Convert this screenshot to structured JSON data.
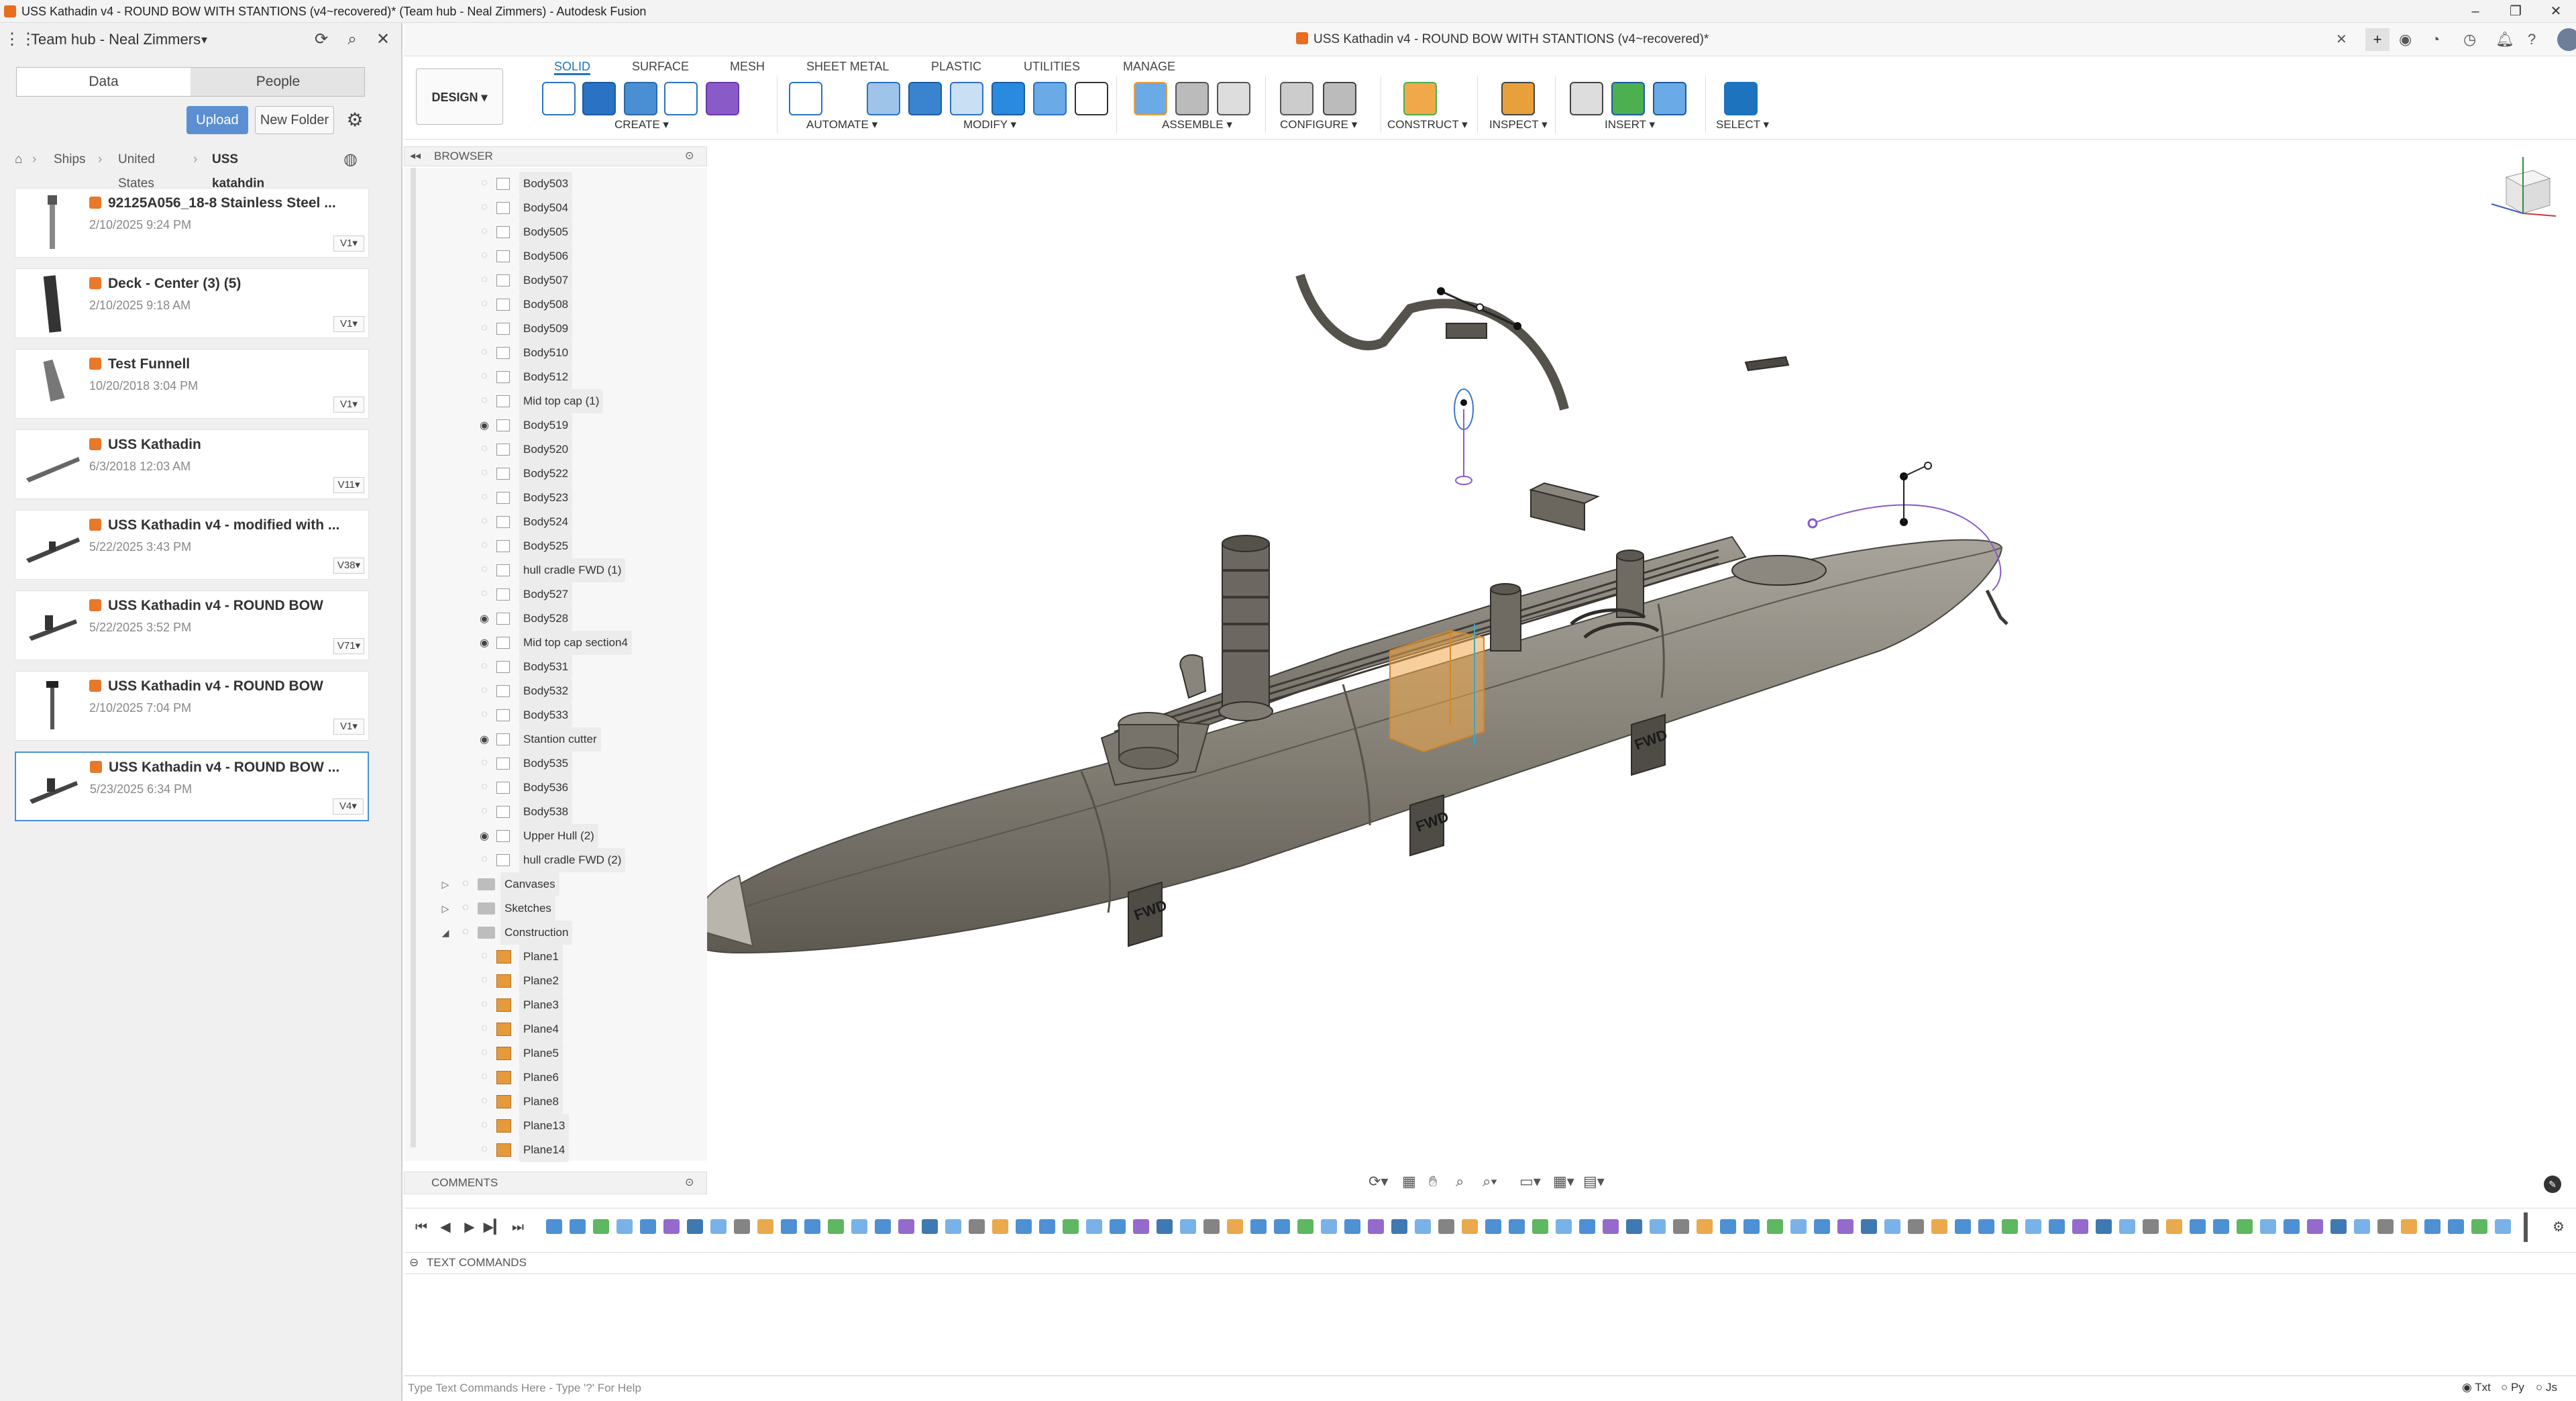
{
  "window": {
    "title": "USS Kathadin v4 - ROUND BOW WITH STANTIONS (v4~recovered)* (Team hub - Neal Zimmers) - Autodesk Fusion",
    "controls": [
      "–",
      "❐",
      "✕"
    ]
  },
  "left_panel": {
    "hub_name": "Team hub - Neal Zimmers",
    "tabs": [
      "Data",
      "People"
    ],
    "active_tab": "Data",
    "upload_label": "Upload",
    "new_folder_label": "New Folder",
    "breadcrumb": [
      "Ships",
      "United States",
      "USS katahdin"
    ],
    "files": [
      {
        "name": "92125A056_18-8 Stainless Steel ...",
        "date": "2/10/2025 9:24 PM",
        "version": "V1▾"
      },
      {
        "name": "Deck - Center (3) (5)",
        "date": "2/10/2025 9:18 AM",
        "version": "V1▾"
      },
      {
        "name": "Test Funnell",
        "date": "10/20/2018 3:04 PM",
        "version": "V1▾"
      },
      {
        "name": "USS Kathadin",
        "date": "6/3/2018 12:03 AM",
        "version": "V11▾"
      },
      {
        "name": "USS Kathadin v4 - modified with ...",
        "date": "5/22/2025 3:43 PM",
        "version": "V38▾"
      },
      {
        "name": "USS Kathadin v4 - ROUND BOW",
        "date": "5/22/2025 3:52 PM",
        "version": "V71▾"
      },
      {
        "name": "USS Kathadin v4 - ROUND BOW",
        "date": "2/10/2025 7:04 PM",
        "version": "V1▾"
      },
      {
        "name": "USS Kathadin v4 - ROUND BOW ...",
        "date": "5/23/2025 6:34 PM",
        "version": "V4▾"
      }
    ]
  },
  "document_tab": {
    "title": "USS Kathadin v4 - ROUND BOW WITH STANTIONS (v4~recovered)*"
  },
  "toolbar": {
    "workspace": "DESIGN ▾",
    "tabs": [
      "SOLID",
      "SURFACE",
      "MESH",
      "SHEET METAL",
      "PLASTIC",
      "UTILITIES",
      "MANAGE"
    ],
    "active_tab": "SOLID",
    "groups": [
      "CREATE ▾",
      "AUTOMATE ▾",
      "MODIFY ▾",
      "ASSEMBLE ▾",
      "CONFIGURE ▾",
      "CONSTRUCT ▾",
      "INSPECT ▾",
      "INSERT ▾",
      "SELECT ▾"
    ]
  },
  "browser": {
    "header": "BROWSER",
    "bodies": [
      {
        "label": "Body503",
        "visible": false
      },
      {
        "label": "Body504",
        "visible": false
      },
      {
        "label": "Body505",
        "visible": false
      },
      {
        "label": "Body506",
        "visible": false
      },
      {
        "label": "Body507",
        "visible": false
      },
      {
        "label": "Body508",
        "visible": false
      },
      {
        "label": "Body509",
        "visible": false
      },
      {
        "label": "Body510",
        "visible": false
      },
      {
        "label": "Body512",
        "visible": false
      },
      {
        "label": "Mid top cap (1)",
        "visible": false
      },
      {
        "label": "Body519",
        "visible": true
      },
      {
        "label": "Body520",
        "visible": false
      },
      {
        "label": "Body522",
        "visible": false
      },
      {
        "label": "Body523",
        "visible": false
      },
      {
        "label": "Body524",
        "visible": false
      },
      {
        "label": "Body525",
        "visible": false
      },
      {
        "label": "hull cradle FWD (1)",
        "visible": false
      },
      {
        "label": "Body527",
        "visible": false
      },
      {
        "label": "Body528",
        "visible": true
      },
      {
        "label": "Mid top cap section4",
        "visible": true
      },
      {
        "label": "Body531",
        "visible": false
      },
      {
        "label": "Body532",
        "visible": false
      },
      {
        "label": "Body533",
        "visible": false
      },
      {
        "label": "Stantion cutter",
        "visible": true
      },
      {
        "label": "Body535",
        "visible": false
      },
      {
        "label": "Body536",
        "visible": false
      },
      {
        "label": "Body538",
        "visible": false
      },
      {
        "label": "Upper Hull (2)",
        "visible": true
      },
      {
        "label": "hull cradle FWD (2)",
        "visible": false
      }
    ],
    "folders": [
      {
        "label": "Canvases",
        "expanded": false
      },
      {
        "label": "Sketches",
        "expanded": false
      },
      {
        "label": "Construction",
        "expanded": true
      }
    ],
    "planes": [
      "Plane1",
      "Plane2",
      "Plane3",
      "Plane4",
      "Plane5",
      "Plane6",
      "Plane8",
      "Plane13",
      "Plane14"
    ]
  },
  "comments_label": "COMMENTS",
  "text_commands": {
    "header": "TEXT COMMANDS",
    "placeholder": "Type Text Commands Here - Type '?' For Help",
    "modes": [
      "Txt",
      "Py",
      "Js"
    ],
    "selected_mode": "Txt"
  },
  "viewport_labels": {
    "fwd_1": "FWD",
    "fwd_2": "FWD",
    "fwd_3": "FWD"
  },
  "colors": {
    "accent": "#1e73be",
    "upload": "#5b8fd1",
    "hull": "#8a857c",
    "selection": "#f0a84a"
  }
}
